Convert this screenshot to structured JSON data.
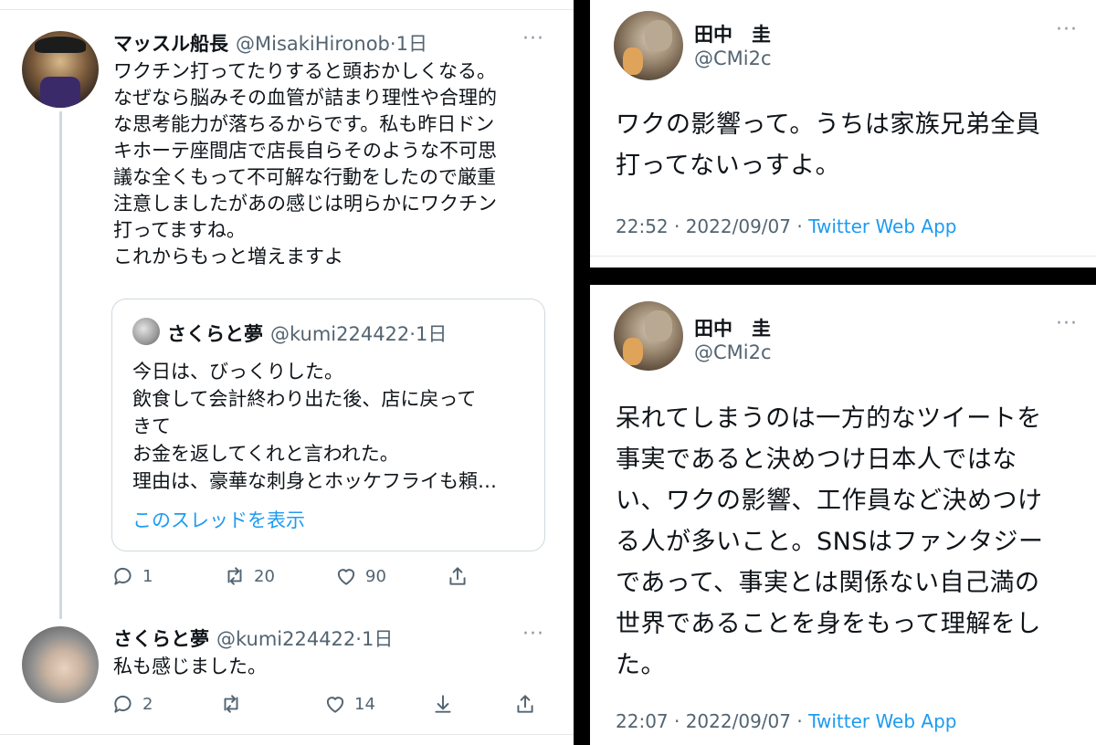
{
  "left_panel": {
    "main_tweet": {
      "name": "マッスル船長",
      "handle": "@MisakiHironob",
      "time": "·1日",
      "more_label": "···",
      "text": "ワクチン打ってたりすると頭おかしくなる。\nなぜなら脳みその血管が詰まり理性や合理的\nな思考能力が落ちるからです。私も昨日ドン\nキホーテ座間店で店長自らそのような不可思\n議な全くもって不可解な行動をしたので厳重\n注意しましたがあの感じは明らかにワクチン\n打ってますね。\nこれからもっと増えますよ",
      "quote": {
        "name": "さくらと夢",
        "handle": "@kumi224422",
        "time": "·1日",
        "text": "今日は、びっくりした。\n飲食して会計終わり出た後、店に戻って\nきて\nお金を返してくれと言われた。\n理由は、豪華な刺身とホッケフライも頼…",
        "show_thread": "このスレッドを表示"
      },
      "actions": {
        "replies": "1",
        "retweets": "20",
        "likes": "90"
      },
      "icons": [
        "reply-icon",
        "retweet-icon",
        "like-icon",
        "share-icon"
      ]
    },
    "reply_tweet": {
      "name": "さくらと夢",
      "handle": "@kumi224422",
      "time": "·1日",
      "more_label": "···",
      "text": "私も感じました。",
      "actions": {
        "replies": "2",
        "retweets": "",
        "likes": "14"
      },
      "icons": [
        "reply-icon",
        "retweet-icon",
        "like-icon",
        "hide-icon",
        "share-icon"
      ]
    }
  },
  "top_right": {
    "name": "田中　圭",
    "handle": "@CMi2c",
    "more_label": "···",
    "text": "ワクの影響って。うちは家族兄弟全員\n打ってないっすよ。",
    "timestamp": "22:52 · 2022/09/07 · ",
    "source": "Twitter Web App"
  },
  "bottom_right": {
    "name": "田中　圭",
    "handle": "@CMi2c",
    "more_label": "···",
    "text": "呆れてしまうのは一方的なツイートを\n事実であると決めつけ日本人ではな\nい、ワクの影響、工作員など決めつけ\nる人が多いこと。SNSはファンタジー\nであって、事実とは関係ない自己満の\n世界であることを身をもって理解をし\nた。",
    "timestamp": "22:07 · 2022/09/07 · ",
    "source": "Twitter Web App"
  },
  "colors": {
    "text": "#0f1419",
    "secondary": "#536471",
    "link": "#1d9bf0",
    "border": "#cfd9de",
    "separator": "#000000"
  }
}
